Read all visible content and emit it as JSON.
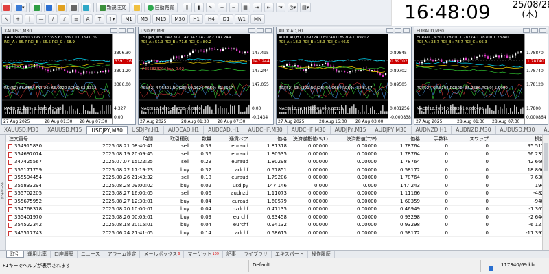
{
  "toolbar": {
    "new_order": "新規注文",
    "auto_trading": "自動売買",
    "timeframes": [
      "M1",
      "M5",
      "M15",
      "M30",
      "H1",
      "H4",
      "D1",
      "W1",
      "MN"
    ]
  },
  "clock": {
    "time": "16:48:09",
    "date": "25/08/28",
    "weekday": "(木)"
  },
  "charts": [
    {
      "title": "XAUUSD,M30",
      "info": "XAUUSD,M30  3395.12 3395.61 3391.11 3391.76",
      "rci": "RCI_A : 36.7  RCI_B : 56.5  RCI_C : 68.9",
      "rci2": "RCI(52) 66.6554  RCI(26) 65.0220  RCI(9) 63.3333",
      "macd": "MACD(12,26,9) 1.3271 4.3493",
      "prices": [
        "3396.30",
        "3391.20",
        "3386.00",
        "4.327",
        "0.00"
      ],
      "cur": "3391.76",
      "times": [
        "27 Aug 2025",
        "28 Aug 01:30",
        "28 Aug 07:30"
      ],
      "color": "#e03cc8"
    },
    {
      "title": "USDJPY,M30",
      "info": "USDJPY,M30  147.312 147.342 147.282 147.244",
      "rci": "RCI_A : 51.3  RCI_B : 71.6  RCI_C : 80.2",
      "rci2": "RCI(52) 47.5801  RCI(26) 69.1624  RCI(9) 81.6667",
      "macd": "MACD(12,26,9) -0.0330 -0.0986",
      "order": "#355833294 buy 0.02",
      "prices": [
        "147.495",
        "147.244",
        "147.055",
        "0.00",
        "-0.1434"
      ],
      "cur": "147.244",
      "times": [
        "27 Aug 2025",
        "28 Aug 01:30",
        "28 Aug 07:30"
      ],
      "color": "#e03cc8"
    },
    {
      "title": "AUDCAD,H1",
      "info": "AUDCAD,H1  0.89724 0.89748 0.89704 0.89702",
      "rci": "RCI_A : 18.3  RCI_B : 18.3  RCI_C : 46.9",
      "rci2": "RCI(52) 53.4321  RCI(26) 36.0684  RCI(9) -32.8167",
      "macd": "MACD(12,26,9) 0.000100 0.00123",
      "prices": [
        "0.89845",
        "0.89702",
        "0.89505",
        "0.001256",
        "-0.000838"
      ],
      "cur": "0.89702",
      "times": [
        "27 Aug 2025",
        "28 Aug 15:00",
        "28 Aug 03:00"
      ],
      "color": "#e03cc8"
    },
    {
      "title": "EURAUD,M30",
      "info": "EURAUD,M30  1.78700 1.78774 1.78700 1.78740",
      "rci": "RCI_A : 33.7  RCI_B : 78.7  RCI_C : 66.3",
      "rci2": "RCI(52) -66.8705  RCI(26) 35.2580  RCI(9) 5.0000",
      "macd": "MACD(12,26,9) 0.000351 0.000486",
      "prices": [
        "1.78870",
        "1.78740",
        "1.78120",
        "1.7800",
        "0.000864"
      ],
      "cur": "1.78740",
      "times": [
        "27 Aug 2025",
        "28 Aug 01:30",
        "28 Aug 07:30"
      ],
      "color": "#e03cc8"
    }
  ],
  "symbol_tabs": [
    "XAUUSD,M30",
    "XAUUSD,M15",
    "USDJPY,M30",
    "USDJPY,H1",
    "AUDCAD,H1",
    "AUDCAD,H1",
    "AUDCHF,M30",
    "AUDCHF,M30",
    "AUDJPY,M15",
    "AUDJPY,M30",
    "AUDNZD,H1",
    "AUDNZD,M30",
    "AUDUSD,M30",
    "AUDUSD,"
  ],
  "active_symbol_tab": 2,
  "headers": [
    "注文番号",
    "時間",
    "取引種別",
    "数量",
    "通貨ペア",
    "価格",
    "決済逆指値(S/L)",
    "決済指値(T/P)",
    "価格",
    "手数料",
    "スワップ",
    "損益"
  ],
  "orders": [
    [
      "354915830",
      "2025.08.21 08:40:41",
      "sell",
      "0.39",
      "euraud",
      "1.81318",
      "0.00000",
      "0.00000",
      "1.78764",
      "0",
      "0",
      "95 517"
    ],
    [
      "354697074",
      "2025.08.19 20:09:45",
      "sell",
      "0.36",
      "euraud",
      "1.80535",
      "0.00000",
      "0.00000",
      "1.78764",
      "0",
      "0",
      "66 233"
    ],
    [
      "347425567",
      "2025.07.07 15:22:25",
      "sell",
      "0.29",
      "euraud",
      "1.80298",
      "0.00000",
      "0.00000",
      "1.78764",
      "0",
      "0",
      "42 660"
    ],
    [
      "355171759",
      "2025.08.22 17:19:23",
      "buy",
      "0.32",
      "cadchf",
      "0.57851",
      "0.00000",
      "0.00000",
      "0.58172",
      "0",
      "0",
      "18 866"
    ],
    [
      "355594454",
      "2025.08.26 21:43:32",
      "sell",
      "0.18",
      "euraud",
      "1.79206",
      "0.00000",
      "0.00000",
      "1.78764",
      "0",
      "0",
      "7 630"
    ],
    [
      "355833294",
      "2025.08.28 09:00:02",
      "buy",
      "0.02",
      "usdjpy",
      "147.146",
      "0.000",
      "0.000",
      "147.243",
      "0",
      "0",
      "194"
    ],
    [
      "355702205",
      "2025.08.27 16:00:05",
      "sell",
      "0.06",
      "audnzd",
      "1.11073",
      "0.00000",
      "0.00000",
      "1.11166",
      "0",
      "0",
      "-482"
    ],
    [
      "355675952",
      "2025.08.27 12:30:01",
      "buy",
      "0.04",
      "eurcad",
      "1.60579",
      "0.00000",
      "0.00000",
      "1.60359",
      "0",
      "0",
      "-940"
    ],
    [
      "354768378",
      "2025.08.20 10:00:01",
      "buy",
      "0.04",
      "nzdchf",
      "0.47135",
      "0.00000",
      "0.00000",
      "0.46949",
      "0",
      "0",
      "-1 367"
    ],
    [
      "355401970",
      "2025.08.26 00:05:01",
      "buy",
      "0.09",
      "eurchf",
      "0.93458",
      "0.00000",
      "0.00000",
      "0.93298",
      "0",
      "0",
      "-2 644"
    ],
    [
      "354522342",
      "2025.08.18 20:15:01",
      "buy",
      "0.04",
      "eurchf",
      "0.94132",
      "0.00000",
      "0.00000",
      "0.93298",
      "0",
      "0",
      "-6 127"
    ],
    [
      "345517743",
      "2025.06.24 21:41:05",
      "buy",
      "0.14",
      "cadchf",
      "0.58615",
      "0.00000",
      "0.00000",
      "0.58172",
      "0",
      "0",
      "-11 391"
    ]
  ],
  "side_label": "ターミナル",
  "bottom_tabs": [
    {
      "label": "取引",
      "badge": ""
    },
    {
      "label": "運用比率",
      "badge": ""
    },
    {
      "label": "口座履歴",
      "badge": ""
    },
    {
      "label": "ニュース",
      "badge": ""
    },
    {
      "label": "アラーム設定",
      "badge": ""
    },
    {
      "label": "メールボックス",
      "badge": "6"
    },
    {
      "label": "マーケット",
      "badge": "109"
    },
    {
      "label": "記事",
      "badge": ""
    },
    {
      "label": "ライブラリ",
      "badge": ""
    },
    {
      "label": "エキスパート",
      "badge": ""
    },
    {
      "label": "操作履歴",
      "badge": ""
    }
  ],
  "status": {
    "help": "F1キーでヘルプが表示されます",
    "profile": "Default",
    "traffic": "117340/69 kb"
  }
}
